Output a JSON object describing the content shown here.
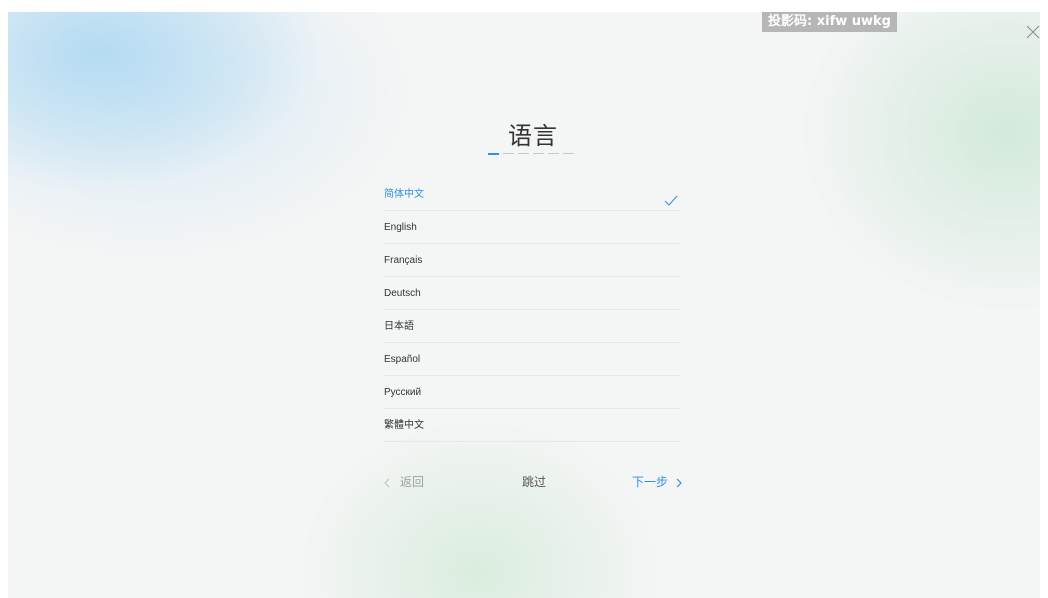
{
  "watermark": "投影码: xifw uwkg",
  "title": "语言",
  "steps": {
    "total": 6,
    "current": 1
  },
  "languages": [
    {
      "label": "简体中文",
      "selected": true
    },
    {
      "label": "English",
      "selected": false
    },
    {
      "label": "Français",
      "selected": false
    },
    {
      "label": "Deutsch",
      "selected": false
    },
    {
      "label": "日本語",
      "selected": false
    },
    {
      "label": "Español",
      "selected": false
    },
    {
      "label": "Русский",
      "selected": false
    },
    {
      "label": "繁體中文",
      "selected": false
    }
  ],
  "nav": {
    "back": "返回",
    "skip": "跳过",
    "next": "下一步"
  },
  "colors": {
    "accent": "#2f8fe9",
    "text": "#333333",
    "disabled": "#a0a0a0"
  }
}
